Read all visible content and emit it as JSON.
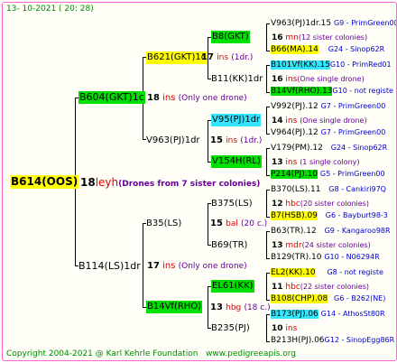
{
  "header": {
    "date": "13- 10-2021 ( 20: 28)"
  },
  "footer": {
    "copyright": "Copyright 2004-2021 @ Karl Kehrle Foundation",
    "site": "www.pedigreeapis.org"
  },
  "root": {
    "id": "B614(OOS)",
    "gen": "18",
    "breeder": "leyh",
    "note": "(Drones from 7 sister colonies)"
  },
  "gen1": {
    "a": {
      "id": "B604(GKT)1c",
      "gen": "18",
      "breeder": "ins",
      "note": "(Only one drone)"
    },
    "b": {
      "id": "B114(LS)1dr",
      "gen": "17",
      "breeder": "ins",
      "note": "(Only one drone)"
    }
  },
  "gen2": {
    "a": {
      "id": "B621(GKT)1c",
      "gen": "17",
      "breeder": "ins",
      "note": "(1dr.)"
    },
    "b": {
      "id": "V963(PJ)1dr",
      "gen": "15",
      "breeder": "ins",
      "note": "(1dr.)"
    },
    "c": {
      "id": "B35(LS)",
      "gen": "15",
      "breeder": "bal",
      "note": "(20 c.)"
    },
    "d": {
      "id": "B14Vf(RHO)",
      "gen": "13",
      "breeder": "hbg",
      "note": "(18 c.)"
    }
  },
  "gen3": {
    "a": {
      "id": "B8(GKT)"
    },
    "b": {
      "id": "B11(KK)1dr",
      "gen": "16",
      "breeder": "ins",
      "note": "(One single drone)"
    },
    "c": {
      "id": "V95(PJ)1dr",
      "gen": "14",
      "breeder": "ins",
      "note": "(One single drone)"
    },
    "d": {
      "id": "V154H(RL)",
      "gen": "13",
      "breeder": "ins",
      "note": "(1 single colony)"
    },
    "e": {
      "id": "B375(LS)",
      "gen": "12",
      "breeder": "hbc",
      "note": "(20 sister colonies)"
    },
    "f": {
      "id": "B69(TR)",
      "gen": "13",
      "breeder": "mdr",
      "note": "(24 sister colonies)"
    },
    "g": {
      "id": "EL61(KK)",
      "gen": "11",
      "breeder": "hbc",
      "note": "(22 sister colonies)"
    },
    "h": {
      "id": "B235(PJ)",
      "gen": "10",
      "breeder": "ins"
    }
  },
  "gen4": {
    "r1": {
      "id": "V963(PJ)1dr.15",
      "ref": "G9 - PrimGreen00"
    },
    "r2": {
      "gen": "16",
      "breeder": "mn",
      "note": "(12 sister colonies)"
    },
    "r3": {
      "id": "B66(MA).14",
      "ref": "G24 - Sinop62R"
    },
    "r4": {
      "id": "B101Vf(KK).15",
      "ref": "G10 - PrimRed01"
    },
    "r5": {
      "id": "B14Vf(RHO).13",
      "ref": "G10 - not registe"
    },
    "r6": {
      "id": "V992(PJ).12",
      "ref": "G7 - PrimGreen00"
    },
    "r7": {
      "id": "V964(PJ).12",
      "ref": "G7 - PrimGreen00"
    },
    "r8": {
      "id": "V179(PM).12",
      "ref": "G24 - Sinop62R"
    },
    "r9": {
      "id": "P214(PJ).10",
      "ref": "G5 - PrimGreen00"
    },
    "r10": {
      "id": "B370(LS).11",
      "ref": "G8 - Cankiri97Q"
    },
    "r11": {
      "id": "B7(HSB).09",
      "ref": "G6 - Bayburt98-3"
    },
    "r12": {
      "id": "B63(TR).12",
      "ref": "G9 - Kangaroo98R"
    },
    "r13": {
      "id": "B129(TR).10",
      "ref": "G10 - N06294R"
    },
    "r14": {
      "id": "EL2(KK).10",
      "ref": "G8 - not registe"
    },
    "r15": {
      "id": "B108(CHP).08",
      "ref": "G6 - B262(NE)"
    },
    "r16": {
      "id": "B173(PJ).06",
      "ref": "G14 - AthosSt80R"
    },
    "r17": {
      "id": "B213H(PJ).06",
      "ref": "G12 - SinopEgg86R"
    }
  }
}
